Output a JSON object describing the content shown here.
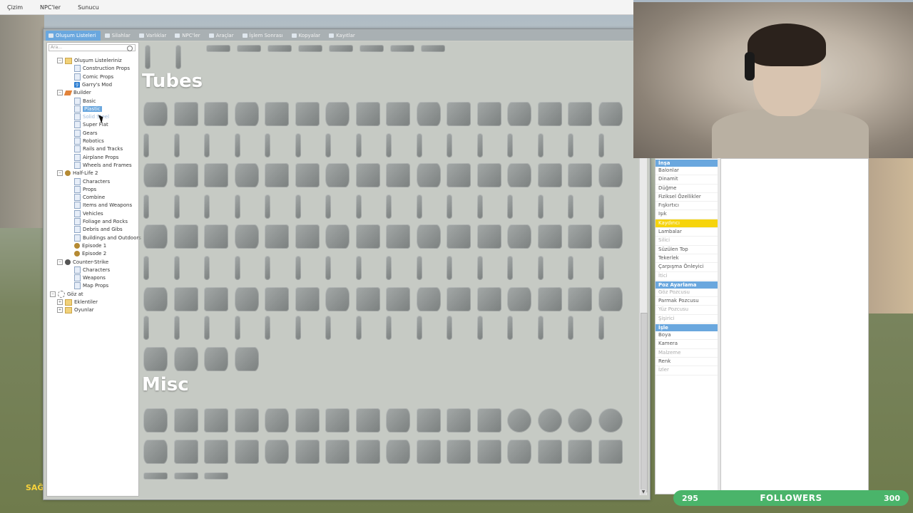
{
  "menubar": [
    "Çizim",
    "NPC'ler",
    "Sunucu"
  ],
  "tabs": [
    {
      "label": "Oluşum Listeleri",
      "active": true
    },
    {
      "label": "Silahlar"
    },
    {
      "label": "Varlıklar"
    },
    {
      "label": "NPC'ler"
    },
    {
      "label": "Araçlar"
    },
    {
      "label": "İşlem Sonrası"
    },
    {
      "label": "Kopyalar"
    },
    {
      "label": "Kayıtlar"
    }
  ],
  "search": {
    "placeholder": "Ara..."
  },
  "tree": [
    {
      "label": "Oluşum Listeleriniz",
      "icon": "folder",
      "level": 0,
      "expander": "⊟"
    },
    {
      "label": "Construction Props",
      "icon": "doc",
      "level": 1
    },
    {
      "label": "Comic Props",
      "icon": "doc",
      "level": 1
    },
    {
      "label": "Garry's Mod",
      "icon": "gmod",
      "level": 1
    },
    {
      "label": "Builder",
      "icon": "tool",
      "level": 0,
      "expander": "⊟"
    },
    {
      "label": "Basic",
      "icon": "doc",
      "level": 1
    },
    {
      "label": "Plastic",
      "icon": "doc",
      "level": 1,
      "state": "selected"
    },
    {
      "label": "Solid Steel",
      "icon": "doc",
      "level": 1,
      "state": "hover"
    },
    {
      "label": "Super Flat",
      "icon": "doc",
      "level": 1
    },
    {
      "label": "Gears",
      "icon": "doc",
      "level": 1
    },
    {
      "label": "Robotics",
      "icon": "doc",
      "level": 1
    },
    {
      "label": "Rails and Tracks",
      "icon": "doc",
      "level": 1
    },
    {
      "label": "Airplane Props",
      "icon": "doc",
      "level": 1
    },
    {
      "label": "Wheels and Frames",
      "icon": "doc",
      "level": 1
    },
    {
      "label": "Half-Life 2",
      "icon": "hl",
      "level": 0,
      "expander": "⊟"
    },
    {
      "label": "Characters",
      "icon": "doc",
      "level": 1
    },
    {
      "label": "Props",
      "icon": "doc",
      "level": 1
    },
    {
      "label": "Combine",
      "icon": "doc",
      "level": 1
    },
    {
      "label": "Items and Weapons",
      "icon": "doc",
      "level": 1
    },
    {
      "label": "Vehicles",
      "icon": "doc",
      "level": 1
    },
    {
      "label": "Foliage and Rocks",
      "icon": "doc",
      "level": 1
    },
    {
      "label": "Debris and Gibs",
      "icon": "doc",
      "level": 1
    },
    {
      "label": "Buildings and Outdoors",
      "icon": "doc",
      "level": 1
    },
    {
      "label": "Episode 1",
      "icon": "hl",
      "level": 1
    },
    {
      "label": "Episode 2",
      "icon": "hl",
      "level": 1
    },
    {
      "label": "Counter-Strike",
      "icon": "cs",
      "level": 0,
      "expander": "⊟"
    },
    {
      "label": "Characters",
      "icon": "doc",
      "level": 1
    },
    {
      "label": "Weapons",
      "icon": "doc",
      "level": 1
    },
    {
      "label": "Map Props",
      "icon": "doc",
      "level": 1
    },
    {
      "label": "Göz at",
      "icon": "gear",
      "level": -1,
      "expander": "⊟"
    },
    {
      "label": "Eklentiler",
      "icon": "folder",
      "level": 0,
      "expander": "⊞"
    },
    {
      "label": "Oyunlar",
      "icon": "folder",
      "level": 0,
      "expander": "⊞"
    }
  ],
  "sections": [
    {
      "title": "Tubes"
    },
    {
      "title": "Misc"
    }
  ],
  "context_menu": [
    {
      "type": "header",
      "label": "İnşa"
    },
    {
      "label": "Balonlar"
    },
    {
      "label": "Dinamit"
    },
    {
      "label": "Düğme"
    },
    {
      "label": "Fiziksel Özellikler"
    },
    {
      "label": "Fışkırtıcı"
    },
    {
      "label": "Işık"
    },
    {
      "label": "Kaydırıcı",
      "state": "hot"
    },
    {
      "label": "Lambalar"
    },
    {
      "label": "Silici",
      "state": "fade"
    },
    {
      "label": "Süzülen Top"
    },
    {
      "label": "Tekerlek"
    },
    {
      "label": "Çarpışma Önleyici"
    },
    {
      "label": "İtici",
      "state": "fade"
    },
    {
      "type": "header",
      "label": "Poz Ayarlama"
    },
    {
      "label": "Göz Pozcusu",
      "state": "fade"
    },
    {
      "label": "Parmak Pozcusu"
    },
    {
      "label": "Yüz Pozcusu",
      "state": "fade"
    },
    {
      "label": "Şişirici",
      "state": "fade"
    },
    {
      "type": "header",
      "label": "İşle"
    },
    {
      "label": "Boya"
    },
    {
      "label": "Kamera"
    },
    {
      "label": "Malzeme",
      "state": "fade"
    },
    {
      "label": "Renk"
    },
    {
      "label": "İzler",
      "state": "fade"
    }
  ],
  "followers": {
    "current": "295",
    "label": "FOLLOWERS",
    "goal": "300"
  },
  "hud": {
    "text": "SAĞ"
  },
  "colors": {
    "accent": "#6aa7de",
    "hot": "#f6d40c",
    "followers_bar": "#4ab46a"
  }
}
